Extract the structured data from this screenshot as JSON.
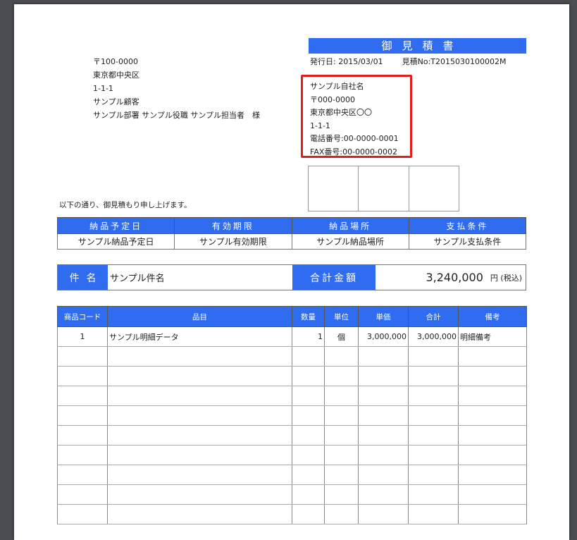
{
  "document": {
    "title": "御見積書",
    "issue_date_label": "発行日:",
    "issue_date": "2015/03/01",
    "estimate_no_label": "見積No:",
    "estimate_no": "T2015030100002M"
  },
  "customer": {
    "postal": "〒100-0000",
    "address1": "東京都中央区",
    "address2": "1-1-1",
    "name": "サンプル顧客",
    "contact": "サンプル部署 サンプル役職 サンプル担当者　様"
  },
  "sender": {
    "company": "サンプル自社名",
    "postal": "〒000-0000",
    "address1": "東京都中央区〇〇",
    "address2": "1-1-1",
    "phone": "電話番号:00-0000-0001",
    "fax": "FAX番号:00-0000-0002"
  },
  "greeting": "以下の通り、御見積もり申し上げます。",
  "info": {
    "headers": [
      "納品予定日",
      "有効期限",
      "納品場所",
      "支払条件"
    ],
    "values": [
      "サンプル納品予定日",
      "サンプル有効期限",
      "サンプル納品場所",
      "サンプル支払条件"
    ]
  },
  "summary": {
    "subject_label": "件名",
    "subject_value": "サンプル件名",
    "total_label": "合計金額",
    "total_value": "3,240,000",
    "total_unit": "円 (税込)"
  },
  "items": {
    "headers": [
      "商品コード",
      "品目",
      "数量",
      "単位",
      "単価",
      "合計",
      "備考"
    ],
    "rows": [
      [
        "1",
        "サンプル明細データ",
        "1",
        "個",
        "3,000,000",
        "3,000,000",
        "明細備考"
      ]
    ]
  }
}
